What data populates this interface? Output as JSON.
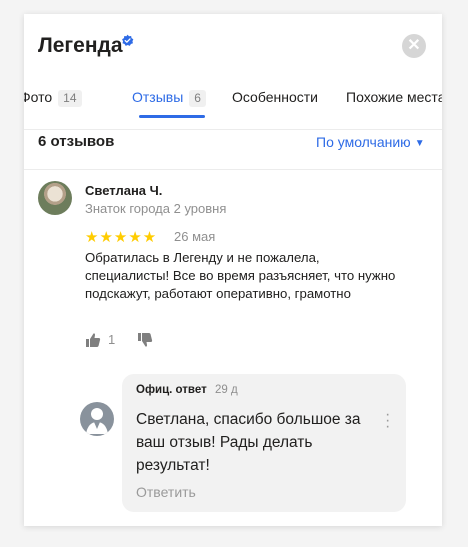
{
  "header": {
    "title": "Легенда",
    "close_icon": "close-icon",
    "verified_icon": "verified-badge-icon"
  },
  "tabs": [
    {
      "label": "Фото",
      "count": "14",
      "active": false
    },
    {
      "label": "Отзывы",
      "count": "6",
      "active": true
    },
    {
      "label": "Особенности",
      "active": false
    },
    {
      "label": "Похожие места",
      "active": false
    }
  ],
  "reviews": {
    "count_label": "6 отзывов",
    "sort_label": "По умолчанию",
    "sort_icon": "caret-down-icon"
  },
  "review": {
    "author": "Светлана Ч.",
    "author_level": "Знаток города 2 уровня",
    "rating": 5,
    "stars": "★★★★★",
    "date": "26 мая",
    "text": "Обратилась в Легенду и не пожалела, специалисты! Все во время разъясняет, что нужно подскажут, работают оперативно, грамотно",
    "likes": "1",
    "like_icon": "thumbs-up-icon",
    "dislike_icon": "thumbs-down-icon"
  },
  "reply": {
    "label": "Офиц. ответ",
    "date": "29 д",
    "text": "Светлана, спасибо большое за ваш отзыв! Рады делать результат!",
    "answer_label": "Ответить",
    "more_icon": "more-vertical-icon"
  },
  "colors": {
    "accent": "#2e6be6",
    "star": "#ffcc00",
    "muted": "#8f8f8f"
  }
}
